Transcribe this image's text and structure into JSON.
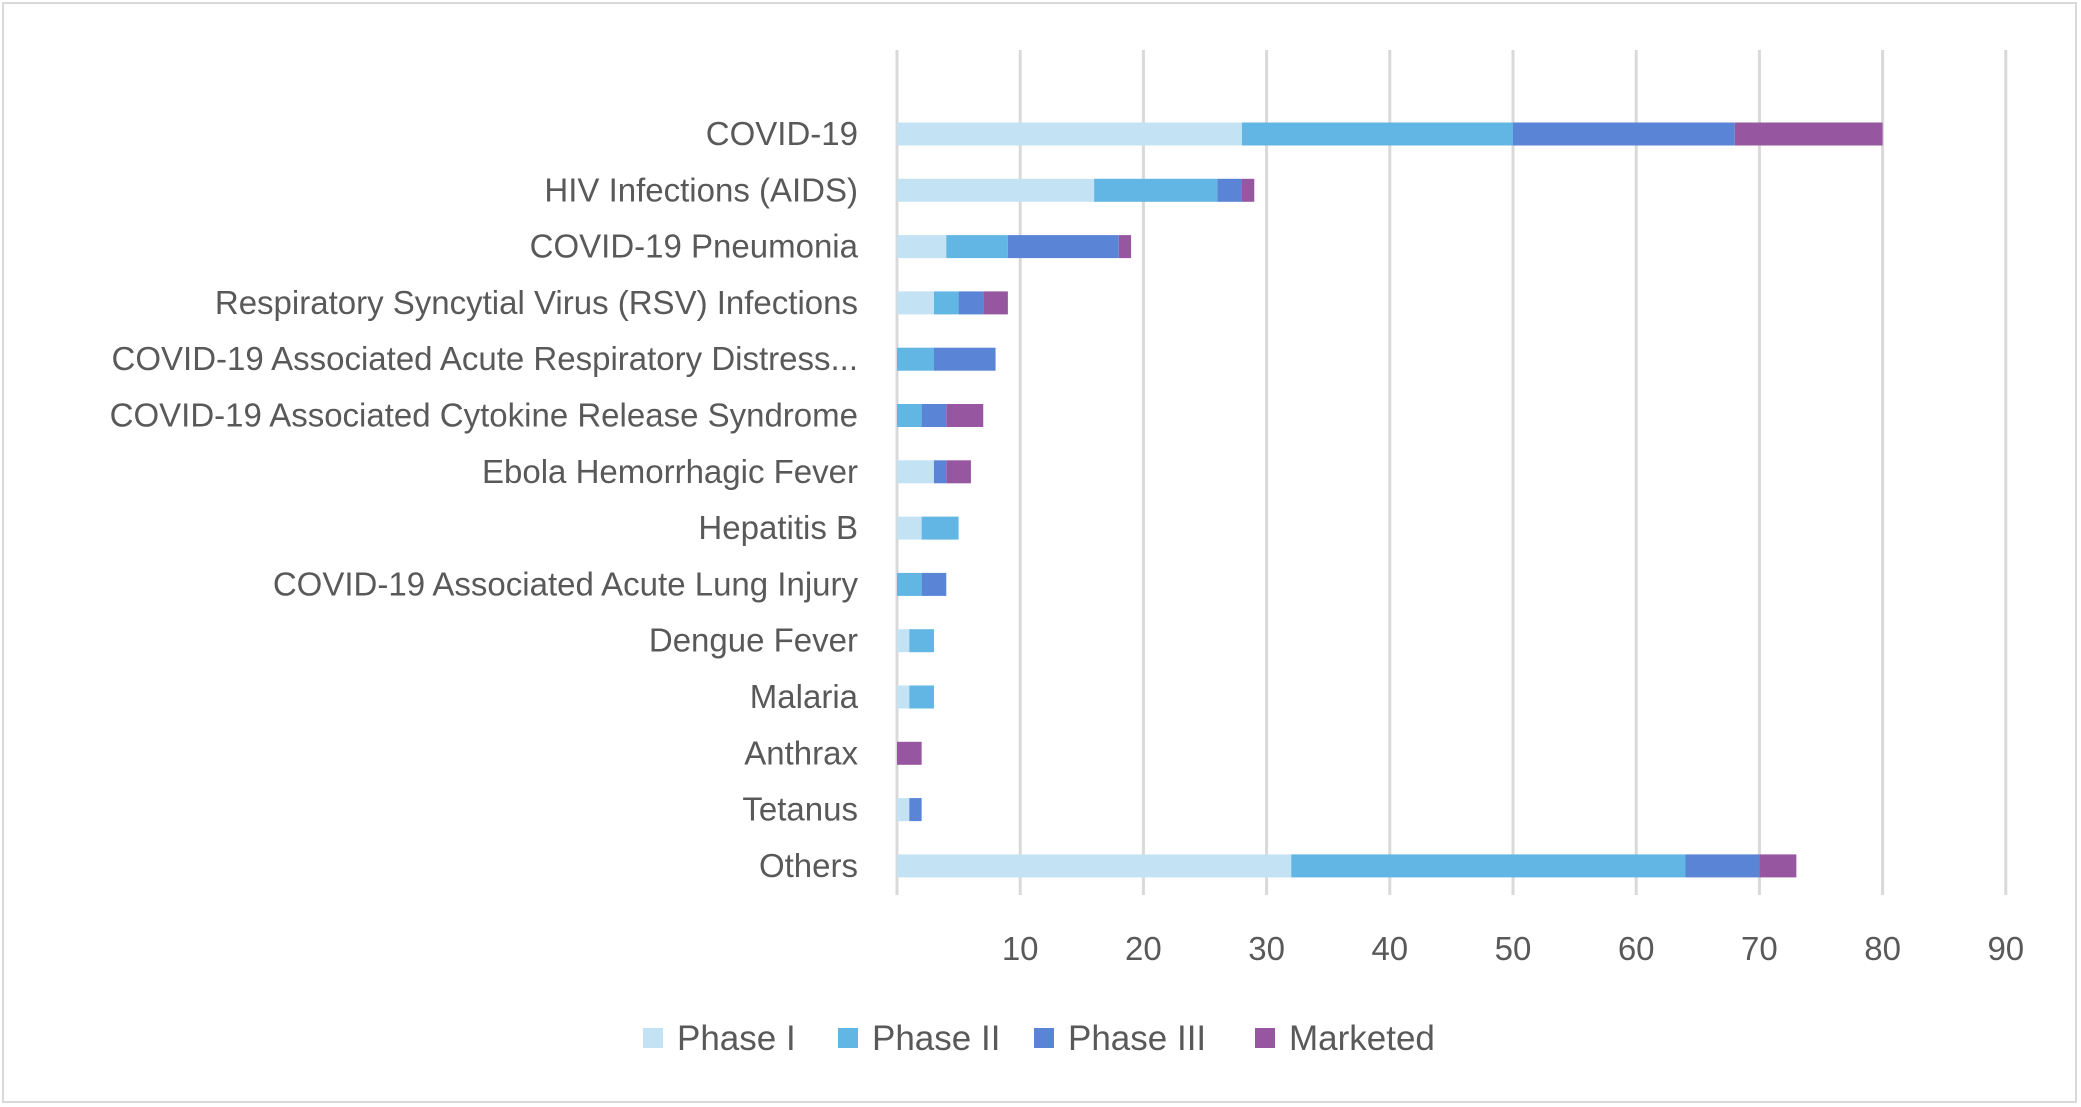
{
  "chart_data": {
    "type": "bar",
    "orientation": "horizontal",
    "stacked": true,
    "title": "",
    "xlabel": "",
    "ylabel": "",
    "xlim": [
      0,
      90
    ],
    "x_ticks": [
      10,
      20,
      30,
      40,
      50,
      60,
      70,
      80,
      90
    ],
    "grid": true,
    "legend_position": "bottom",
    "categories": [
      "COVID-19",
      "HIV Infections (AIDS)",
      "COVID-19 Pneumonia",
      "Respiratory Syncytial Virus (RSV) Infections",
      "COVID-19 Associated Acute Respiratory Distress...",
      "COVID-19 Associated Cytokine Release Syndrome",
      "Ebola Hemorrhagic Fever",
      "Hepatitis B",
      "COVID-19 Associated Acute Lung Injury",
      "Dengue Fever",
      "Malaria",
      "Anthrax",
      "Tetanus",
      "Others"
    ],
    "series": [
      {
        "name": "Phase I",
        "color": "#c3e3f4",
        "values": [
          28,
          16,
          4,
          3,
          0,
          0,
          3,
          2,
          0,
          1,
          1,
          0,
          1,
          32
        ]
      },
      {
        "name": "Phase II",
        "color": "#61b6e3",
        "values": [
          22,
          10,
          5,
          2,
          3,
          2,
          0,
          3,
          2,
          2,
          2,
          0,
          0,
          32
        ]
      },
      {
        "name": "Phase III",
        "color": "#5a84d5",
        "values": [
          18,
          2,
          9,
          2,
          5,
          2,
          1,
          0,
          2,
          0,
          0,
          0,
          1,
          6
        ]
      },
      {
        "name": "Marketed",
        "color": "#9757a0",
        "values": [
          12,
          1,
          1,
          2,
          0,
          3,
          2,
          0,
          0,
          0,
          0,
          2,
          0,
          3
        ]
      }
    ]
  },
  "colors": {
    "gridline": "#d9d9d9",
    "text": "#595959",
    "border": "#d9d9d9"
  }
}
